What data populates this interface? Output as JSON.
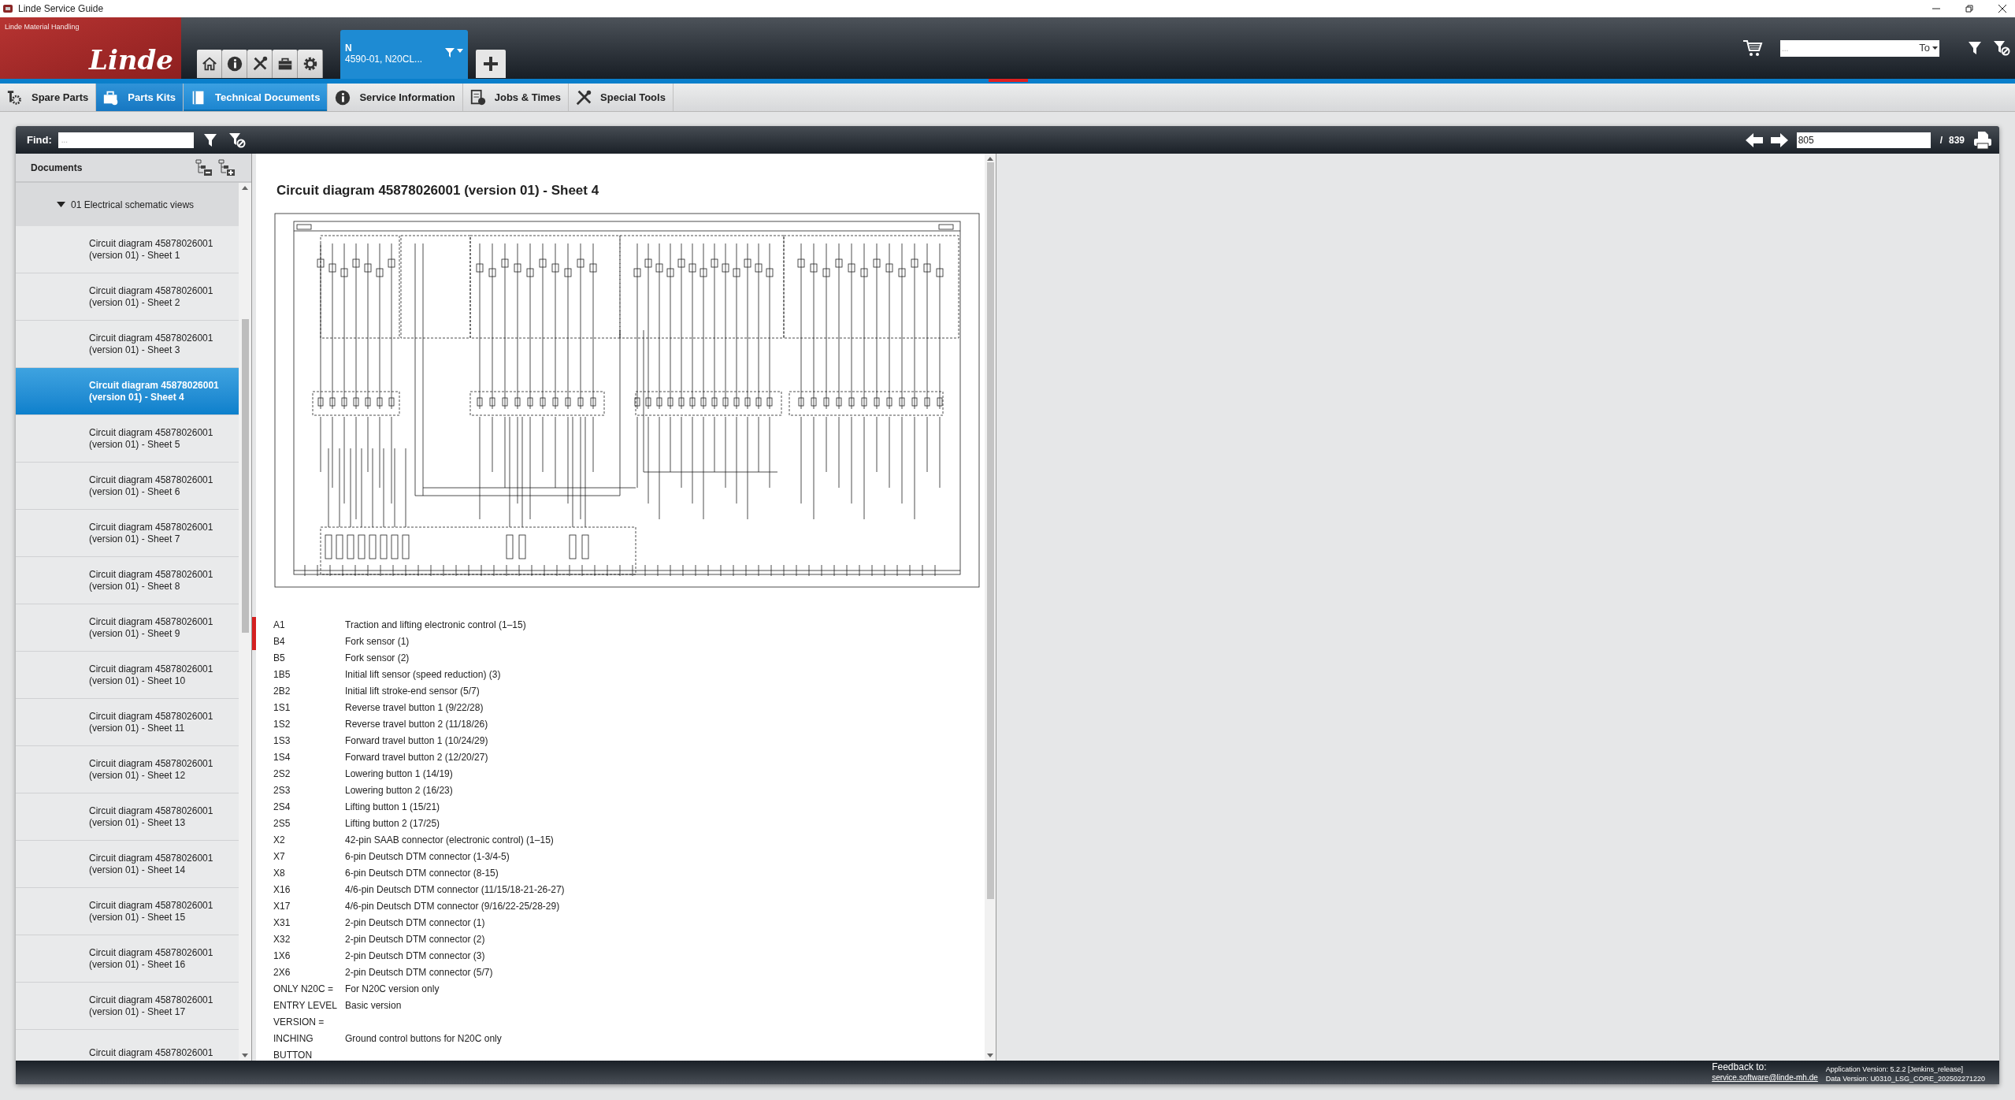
{
  "window": {
    "title": "Linde Service Guide"
  },
  "header": {
    "brand_tagline": "Linde Material Handling",
    "logo_text": "Linde",
    "vehicle_tab": {
      "series": "N",
      "model": "4590-01,  N20CL..."
    },
    "search": {
      "placeholder": "...",
      "type_selector": "To"
    }
  },
  "modules": [
    {
      "label": "Spare Parts",
      "selected": false,
      "highlighted": false
    },
    {
      "label": "Parts Kits",
      "selected": false,
      "highlighted": true
    },
    {
      "label": "Technical Documents",
      "selected": true,
      "highlighted": false
    },
    {
      "label": "Service Information",
      "selected": false,
      "highlighted": false
    },
    {
      "label": "Jobs & Times",
      "selected": false,
      "highlighted": false
    },
    {
      "label": "Special Tools",
      "selected": false,
      "highlighted": false
    }
  ],
  "find": {
    "label": "Find:",
    "placeholder": "..."
  },
  "pager": {
    "page": "805",
    "separator": "/",
    "total": "839"
  },
  "sidebar": {
    "title": "Documents",
    "group": {
      "label": "01 Electrical schematic views",
      "expanded": true,
      "children": [
        {
          "line1": "Circuit diagram 45878026001",
          "line2": "(version 01) - Sheet 1",
          "selected": false
        },
        {
          "line1": "Circuit diagram 45878026001",
          "line2": "(version 01) - Sheet 2",
          "selected": false
        },
        {
          "line1": "Circuit diagram 45878026001",
          "line2": "(version 01) - Sheet 3",
          "selected": false
        },
        {
          "line1": "Circuit diagram 45878026001",
          "line2": "(version 01) - Sheet 4",
          "selected": true
        },
        {
          "line1": "Circuit diagram 45878026001",
          "line2": "(version 01) - Sheet 5",
          "selected": false
        },
        {
          "line1": "Circuit diagram 45878026001",
          "line2": "(version 01) - Sheet 6",
          "selected": false
        },
        {
          "line1": "Circuit diagram 45878026001",
          "line2": "(version 01) - Sheet 7",
          "selected": false
        },
        {
          "line1": "Circuit diagram 45878026001",
          "line2": "(version 01) - Sheet 8",
          "selected": false
        },
        {
          "line1": "Circuit diagram 45878026001",
          "line2": "(version 01) - Sheet 9",
          "selected": false
        },
        {
          "line1": "Circuit diagram 45878026001",
          "line2": "(version 01) - Sheet 10",
          "selected": false
        },
        {
          "line1": "Circuit diagram 45878026001",
          "line2": "(version 01) - Sheet 11",
          "selected": false
        },
        {
          "line1": "Circuit diagram 45878026001",
          "line2": "(version 01) - Sheet 12",
          "selected": false
        },
        {
          "line1": "Circuit diagram 45878026001",
          "line2": "(version 01) - Sheet 13",
          "selected": false
        },
        {
          "line1": "Circuit diagram 45878026001",
          "line2": "(version 01) - Sheet 14",
          "selected": false
        },
        {
          "line1": "Circuit diagram 45878026001",
          "line2": "(version 01) - Sheet 15",
          "selected": false
        },
        {
          "line1": "Circuit diagram 45878026001",
          "line2": "(version 01) - Sheet 16",
          "selected": false
        },
        {
          "line1": "Circuit diagram 45878026001",
          "line2": "(version 01) - Sheet 17",
          "selected": false
        },
        {
          "line1": "Circuit diagram 45878026001",
          "selected": false
        }
      ]
    }
  },
  "document": {
    "title": "Circuit diagram 45878026001 (version 01) - Sheet 4",
    "legend": [
      {
        "code": "A1",
        "text": "Traction and lifting electronic control (1–15)"
      },
      {
        "code": "B4",
        "text": "Fork sensor (1)"
      },
      {
        "code": "B5",
        "text": "Fork sensor (2)"
      },
      {
        "code": "1B5",
        "text": "Initial lift sensor (speed reduction) (3)"
      },
      {
        "code": "2B2",
        "text": "Initial lift stroke-end sensor (5/7)"
      },
      {
        "code": "1S1",
        "text": "Reverse travel button 1 (9/22/28)"
      },
      {
        "code": "1S2",
        "text": "Reverse travel button 2 (11/18/26)"
      },
      {
        "code": "1S3",
        "text": "Forward travel button 1 (10/24/29)"
      },
      {
        "code": "1S4",
        "text": "Forward travel button 2 (12/20/27)"
      },
      {
        "code": "2S2",
        "text": "Lowering button 1 (14/19)"
      },
      {
        "code": "2S3",
        "text": "Lowering button 2 (16/23)"
      },
      {
        "code": "2S4",
        "text": "Lifting button 1 (15/21)"
      },
      {
        "code": "2S5",
        "text": "Lifting button 2 (17/25)"
      },
      {
        "code": "X2",
        "text": "42-pin SAAB connector (electronic control) (1–15)"
      },
      {
        "code": "X7",
        "text": "6-pin Deutsch DTM connector (1-3/4-5)"
      },
      {
        "code": "X8",
        "text": "6-pin Deutsch DTM connector (8-15)"
      },
      {
        "code": "X16",
        "text": "4/6-pin Deutsch DTM connector (11/15/18-21-26-27)"
      },
      {
        "code": "X17",
        "text": "4/6-pin Deutsch DTM connector (9/16/22-25/28-29)"
      },
      {
        "code": "X31",
        "text": "2-pin Deutsch DTM connector (1)"
      },
      {
        "code": "X32",
        "text": "2-pin Deutsch DTM connector (2)"
      },
      {
        "code": "1X6",
        "text": "2-pin Deutsch DTM connector (3)"
      },
      {
        "code": "2X6",
        "text": "2-pin Deutsch DTM connector (5/7)"
      },
      {
        "code": "ONLY N20C =",
        "text": "For N20C version only"
      },
      {
        "code": "ENTRY LEVEL VERSION =",
        "text": "Basic version"
      },
      {
        "code": "INCHING BUTTON",
        "text": "Ground control buttons for N20C only"
      }
    ]
  },
  "footer": {
    "feedback_label": "Feedback to:",
    "feedback_email": "service.software@linde-mh.de",
    "app_version": "Application Version: 5.2.2 [Jenkins_release]",
    "data_version": "Data Version: U0310_LSG_CORE_202502271220"
  }
}
